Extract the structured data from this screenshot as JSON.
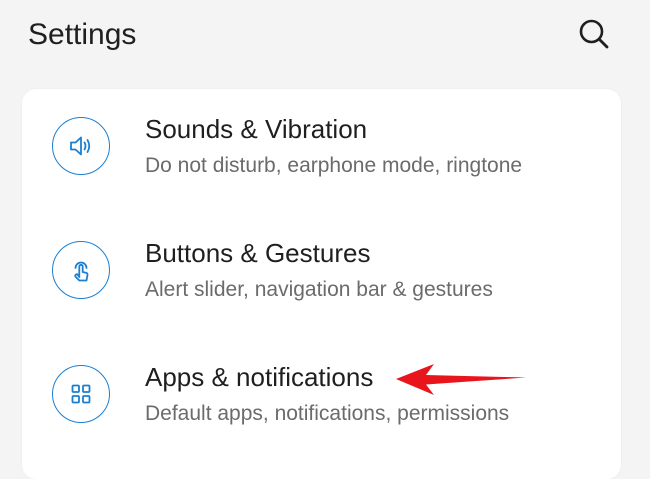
{
  "header": {
    "title": "Settings",
    "search_icon": "search-icon"
  },
  "accent_color": "#1b7fd2",
  "annotation_color": "#e8151c",
  "settings": {
    "items": [
      {
        "title": "Sounds & Vibration",
        "subtitle": "Do not disturb, earphone mode, ringtone",
        "icon": "speaker-icon"
      },
      {
        "title": "Buttons & Gestures",
        "subtitle": "Alert slider, navigation bar & gestures",
        "icon": "touch-gesture-icon"
      },
      {
        "title": "Apps & notifications",
        "subtitle": "Default apps, notifications, permissions",
        "icon": "apps-grid-icon"
      }
    ]
  }
}
